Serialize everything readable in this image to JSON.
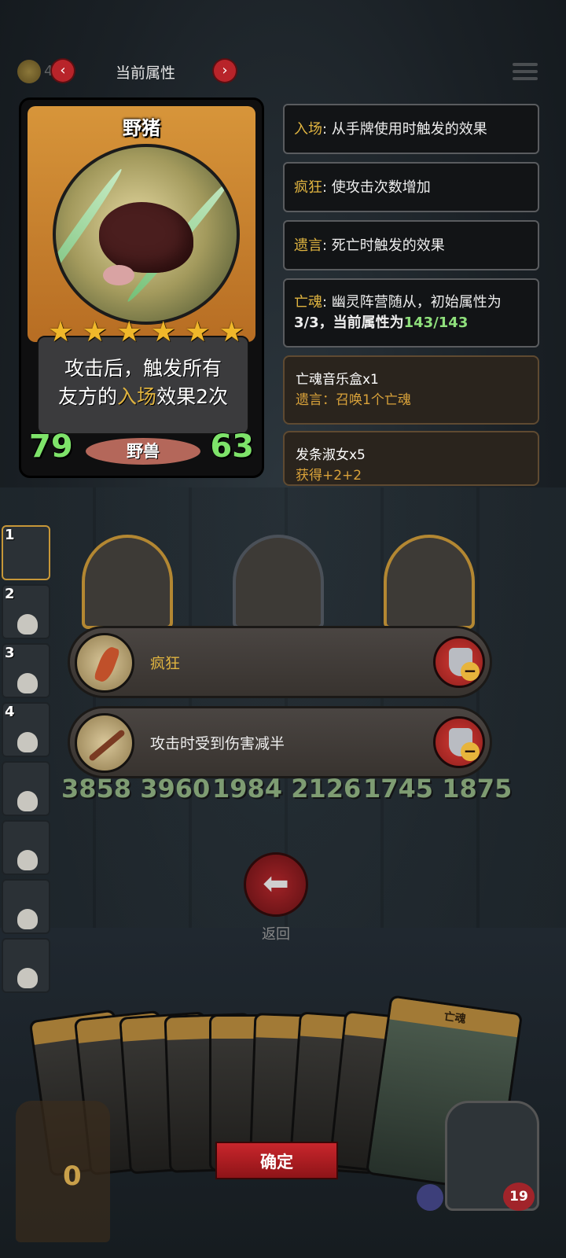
{
  "top_bar": {
    "coin_value": "4..8",
    "title": "当前属性",
    "prev_icon": "chevron-left-icon",
    "next_icon": "chevron-right-icon"
  },
  "card": {
    "name": "野猪",
    "stars": 6,
    "description_pre": "攻击后，触发所有",
    "description_mid_pre": "友方的",
    "description_keyword": "入场",
    "description_post": "效果2次",
    "attack": "79",
    "health": "63",
    "tribe": "野兽"
  },
  "keywords": [
    {
      "key": "入场",
      "text": ": 从手牌使用时触发的效果"
    },
    {
      "key": "疯狂",
      "text": ": 使攻击次数增加"
    },
    {
      "key": "遗言",
      "text": ": 死亡时触发的效果"
    },
    {
      "key": "亡魂",
      "text": ": 幽灵阵营随从，初始属性为",
      "line2_pre": "3/3，当前属性为",
      "line2_value": "143/143"
    }
  ],
  "items": [
    {
      "name": "亡魂音乐盒x1",
      "effect": "遗言：召唤1个亡魂"
    },
    {
      "name": "发条淑女x5",
      "effect": "获得+2+2"
    }
  ],
  "team_slots": [
    {
      "num": "1"
    },
    {
      "num": "2"
    },
    {
      "num": "3"
    },
    {
      "num": "4"
    },
    {
      "num": ""
    },
    {
      "num": ""
    },
    {
      "num": ""
    },
    {
      "num": ""
    }
  ],
  "board_stats": {
    "left": "3858 3960",
    "middle": "1984  2126",
    "right": "1745  1875"
  },
  "buffs": [
    {
      "label": "疯狂",
      "icon": "claw-icon"
    },
    {
      "label": "攻击时受到伤害减半",
      "icon": "crossed-bow-icon"
    }
  ],
  "back_label": "返回",
  "hand_top_card_label": "亡魂",
  "confirm_label": "确定",
  "chest_count": "0",
  "hero_hp": "19"
}
